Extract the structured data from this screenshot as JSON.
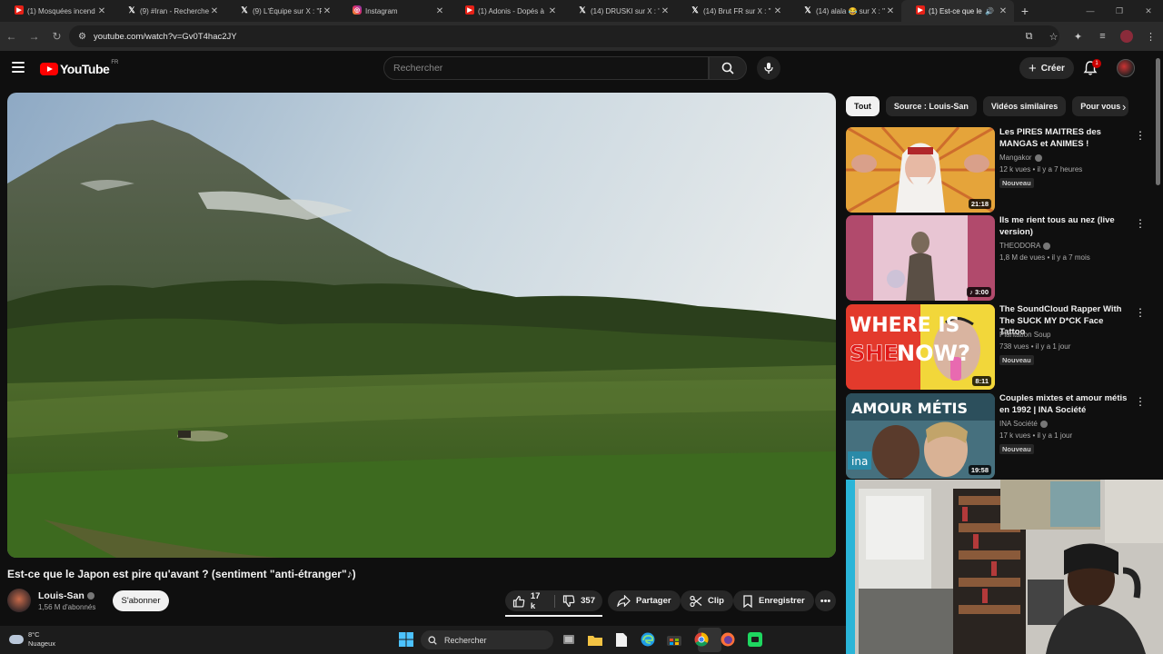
{
  "browser": {
    "tabs": [
      {
        "title": "(1) Mosquées incend",
        "icon": "youtube-icon"
      },
      {
        "title": "(9) #Iran - Recherche",
        "icon": "x-icon"
      },
      {
        "title": "(9) L'Équipe sur X : \"P",
        "icon": "x-icon"
      },
      {
        "title": "Instagram",
        "icon": "instagram-icon"
      },
      {
        "title": "(1) Adonis - Dopés à",
        "icon": "youtube-icon"
      },
      {
        "title": "(14) DRUSKI sur X : \"I",
        "icon": "x-icon"
      },
      {
        "title": "(14) Brut FR sur X : \"",
        "icon": "x-icon"
      },
      {
        "title": "(14) alala 😂 sur X : \"",
        "icon": "x-icon"
      },
      {
        "title": "(1) Est-ce que le",
        "icon": "youtube-icon",
        "active": true
      }
    ],
    "url": "youtube.com/watch?v=Gv0T4hac2JY"
  },
  "youtube": {
    "logo_text": "YouTube",
    "region": "FR",
    "search_placeholder": "Rechercher",
    "create_label": "Créer",
    "notif_count": "1"
  },
  "video": {
    "title": "Est-ce que le Japon est pire qu'avant ? (sentiment \"anti-étranger\"♪)",
    "channel": "Louis-San",
    "subscribers": "1,56 M d'abonnés",
    "subscribe_label": "S'abonner",
    "likes": "17 k",
    "dislikes": "357",
    "share_label": "Partager",
    "clip_label": "Clip",
    "save_label": "Enregistrer"
  },
  "sidebar": {
    "chips": [
      "Tout",
      "Source : Louis-San",
      "Vidéos similaires",
      "Pour vous"
    ],
    "recommendations": [
      {
        "title": "Les PIRES MAITRES des MANGAS et ANIMES !",
        "channel": "Mangakor",
        "meta": "12 k vues • il y a 7 heures",
        "badge": "Nouveau",
        "duration": "21:18"
      },
      {
        "title": "Ils me rient tous au nez (live version)",
        "channel": "THEODORA",
        "meta": "1,8 M de vues • il y a 7 mois",
        "badge": "",
        "duration": "♪ 3:00"
      },
      {
        "title": "The SoundCloud Rapper With The SUCK MY D*CK Face Tattoo",
        "channel": "Plantation Soup",
        "meta": "738 vues • il y a 1 jour",
        "badge": "Nouveau",
        "duration": "8:11"
      },
      {
        "title": "Couples mixtes et amour métis en 1992 | INA Société",
        "channel": "INA Société",
        "meta": "17 k vues • il y a 1 jour",
        "badge": "Nouveau",
        "duration": "19:58"
      }
    ],
    "thumb_texts": {
      "where_line1": "WHERE IS",
      "where_line2a": "SHE",
      "where_line2b": "NOW?",
      "amour": "AMOUR MÉTIS",
      "ina": "ina"
    }
  },
  "taskbar": {
    "temperature": "8°C",
    "condition": "Nuageux",
    "search_label": "Rechercher"
  }
}
